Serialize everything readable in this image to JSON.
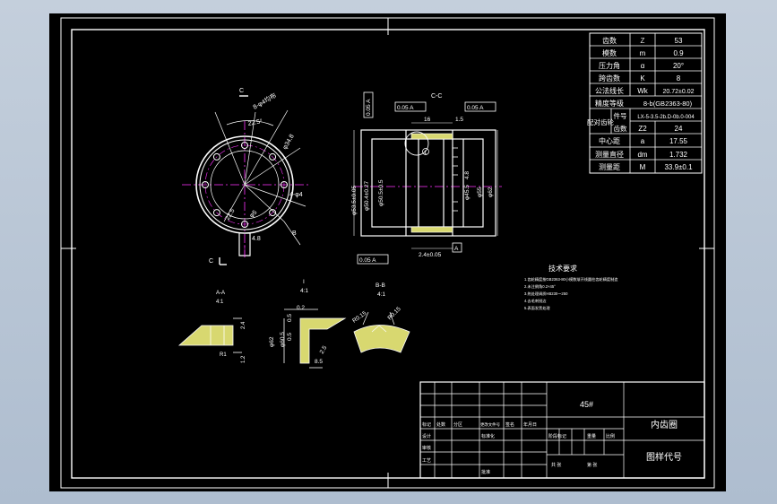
{
  "params": [
    {
      "name": "齿数",
      "sym": "Z",
      "val": "53"
    },
    {
      "name": "模数",
      "sym": "m",
      "val": "0.9"
    },
    {
      "name": "压力角",
      "sym": "α",
      "val": "20°"
    },
    {
      "name": "跨齿数",
      "sym": "K",
      "val": "8"
    },
    {
      "name": "公法线长",
      "sym": "Wk",
      "val": "20.72±0.02"
    },
    {
      "name": "精度等级",
      "sym": "",
      "val": "8-b(GB2363-80)"
    }
  ],
  "pair": {
    "label": "配对齿轮",
    "item1": "件号",
    "val1": "LX-5-3.5-2b.D-0b.0-004",
    "item2": "齿数",
    "sym2": "Z2",
    "val2": "24"
  },
  "params2": [
    {
      "name": "中心距",
      "sym": "a",
      "val": "17.55"
    },
    {
      "name": "测量直径",
      "sym": "dm",
      "val": "1.732"
    },
    {
      "name": "测量距",
      "sym": "M",
      "val": "33.9±0.1"
    }
  ],
  "views": {
    "section_cc": "C-C",
    "cut_c": "C",
    "cut_b": "B",
    "detail1_title": "I",
    "detail1_scale": "4:1",
    "detail2_title": "A-A",
    "detail2_scale": "4:1",
    "detail3_title": "B-B",
    "detail3_scale": "4:1",
    "balloon": "1"
  },
  "dims": {
    "front": [
      "8-φ4均布",
      "22.5°",
      "φ34.8",
      "4-φ4",
      "22.5",
      "φ5",
      "4.8"
    ],
    "section": [
      "16",
      "1.5",
      "φ53.5±0.05",
      "φ50.4±0.27",
      "φ50.5±0.5",
      "φ45.5",
      "φ55",
      "φ62",
      "4.8",
      "2.4±0.05",
      "0.05 A",
      "0.05 A",
      "0.05 A",
      "A"
    ],
    "detail1": [
      "1.5",
      "R1",
      "2.4",
      "1.2"
    ],
    "detail2": [
      "φ62",
      "φ60.5",
      "0.5",
      "2.5",
      "8.5",
      "0.2",
      "0.5"
    ],
    "detail3": [
      "R0.15",
      "R0.15",
      "0.5",
      "0.3"
    ]
  },
  "tech": {
    "title": "技术要求",
    "lines": [
      "1.齿轮精度按GB2363-80小模数渐开线圆柱齿轮精度制造",
      "2.未注倒角0.2×45°",
      "3.热处理调质HB230～250",
      "4.去毛刺锐边",
      "5.表面发黑处理"
    ]
  },
  "title_block": {
    "material": "45#",
    "name": "内齿圈",
    "code": "图样代号",
    "row_labels": [
      "标记",
      "设计",
      "审核",
      "工艺"
    ],
    "col_labels": [
      "处数",
      "分区",
      "更改文件号",
      "签名",
      "年月日"
    ],
    "col_labels2": [
      "标准化",
      "批准"
    ],
    "stage_labels": [
      "阶段标记",
      "重量",
      "比例"
    ],
    "bottom_labels": [
      "共 张",
      "第 张"
    ]
  }
}
